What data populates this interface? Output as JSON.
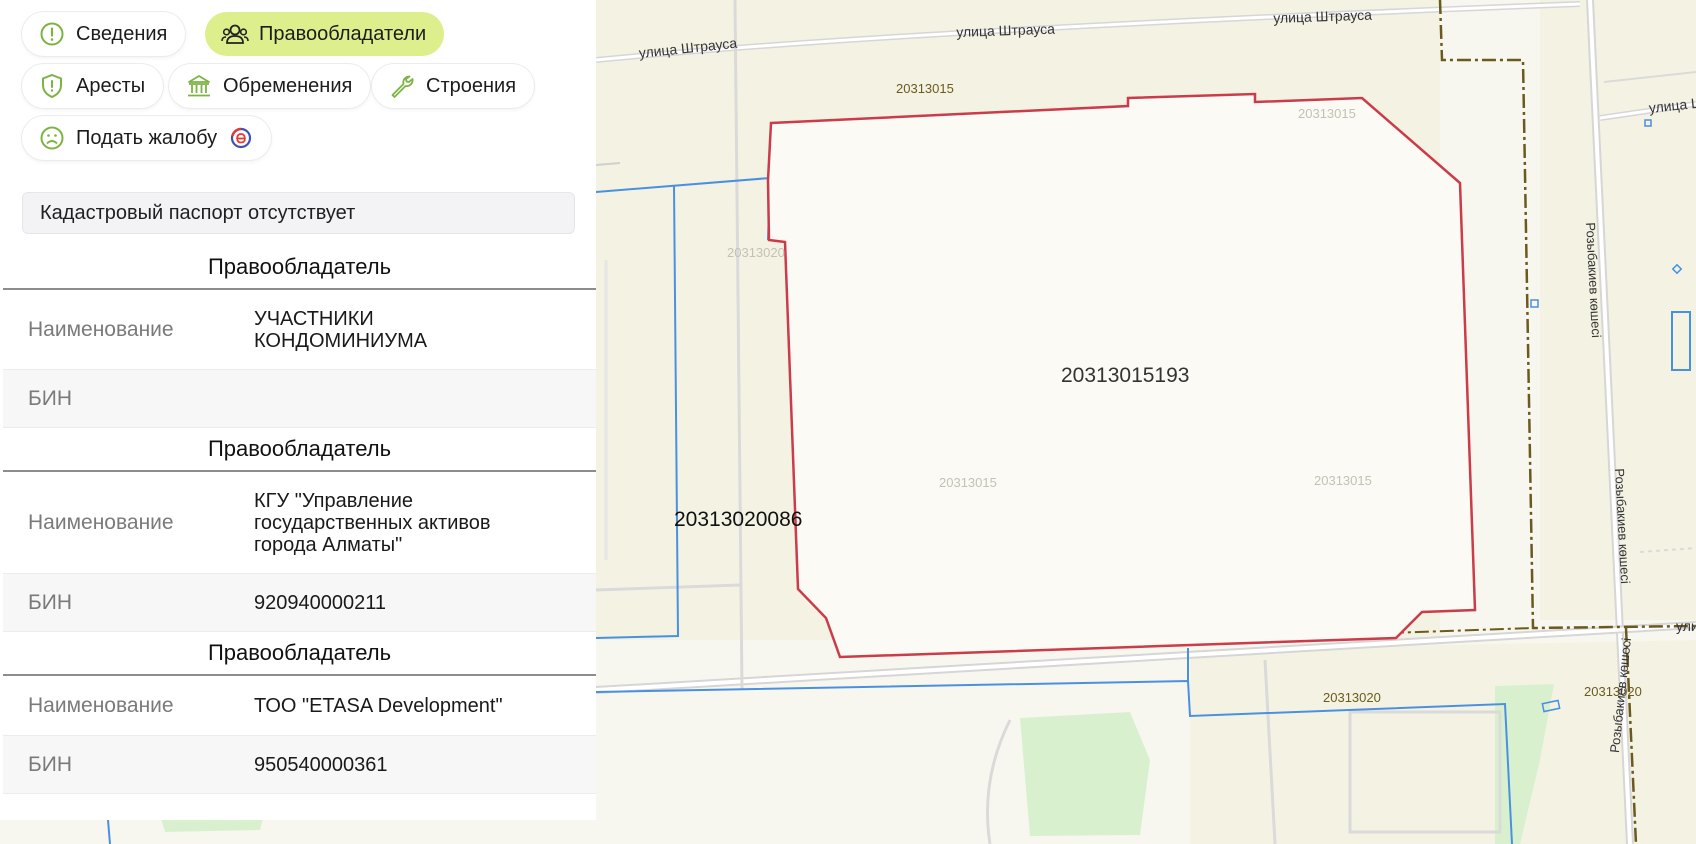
{
  "tabs": [
    {
      "label": "Сведения",
      "icon": "info-circle-icon",
      "active": false
    },
    {
      "label": "Правообладатели",
      "icon": "users-icon",
      "active": true
    },
    {
      "label": "Аресты",
      "icon": "shield-icon",
      "active": false
    },
    {
      "label": "Обременения",
      "icon": "bank-icon",
      "active": false
    },
    {
      "label": "Строения",
      "icon": "wrench-icon",
      "active": false
    },
    {
      "label": "Подать жалобу",
      "icon": "sad-face-icon",
      "active": false
    }
  ],
  "notice": "Кадастровый паспорт отсутствует",
  "holders": [
    {
      "heading": "Правообладатель",
      "name_label": "Наименование",
      "name": "УЧАСТНИКИ КОНДОМИНИУМА",
      "bin_label": "БИН",
      "bin": ""
    },
    {
      "heading": "Правообладатель",
      "name_label": "Наименование",
      "name": "КГУ \"Управление государственных активов города Алматы\"",
      "bin_label": "БИН",
      "bin": "920940000211"
    },
    {
      "heading": "Правообладатель",
      "name_label": "Наименование",
      "name": "ТОО \"ETASA Development\"",
      "bin_label": "БИН",
      "bin": "950540000361"
    }
  ],
  "map": {
    "selected_parcel": "20313015193",
    "neighbor_parcel": "20313020086",
    "quarter_labels": [
      "20313015",
      "20313015",
      "20313020",
      "20313015",
      "20313015",
      "20313020",
      "20313020"
    ],
    "streets": [
      "улица Штрауса",
      "улица Штрауса",
      "улица Штрауса",
      "улица Ш",
      "Розыбакиев көшесі",
      "Розыбакиев көшесі",
      "Розыбакиев көшесі",
      "ули"
    ],
    "colors": {
      "selected": "#cc3b4a",
      "parcel": "#4a90e2",
      "quarter": "#6b5a1e",
      "green": "#d9f0cf",
      "road": "#dcdcdc"
    }
  }
}
